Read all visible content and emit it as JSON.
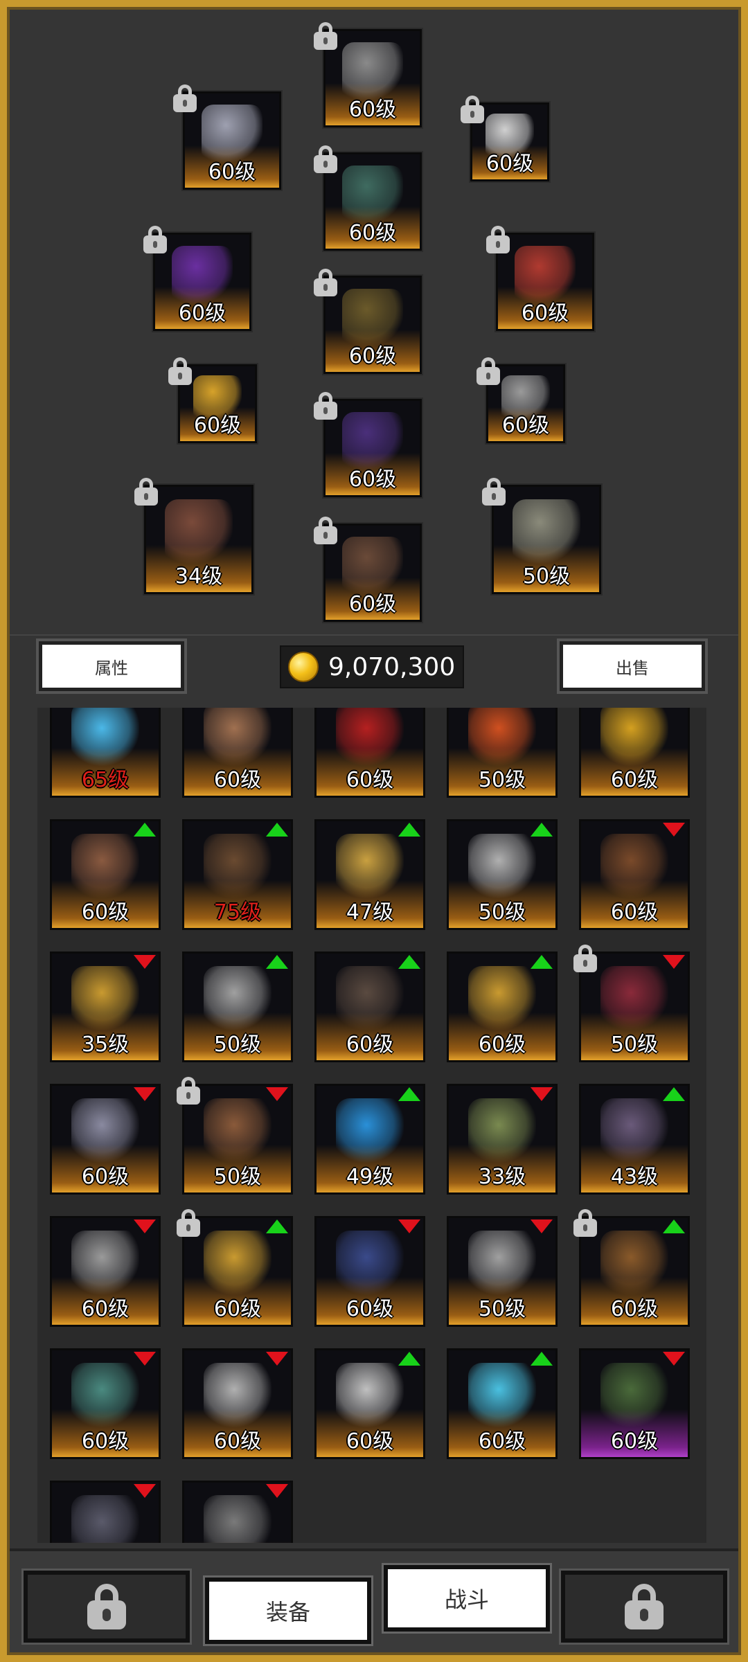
{
  "equipped": [
    {
      "id": "helmet",
      "level": "60级",
      "locked": true,
      "color": "#8a8a8a"
    },
    {
      "id": "mask",
      "level": "60级",
      "locked": true,
      "color": "#9ea0b0"
    },
    {
      "id": "amulet",
      "level": "60级",
      "locked": true,
      "color": "#d0d0d0"
    },
    {
      "id": "armor",
      "level": "60级",
      "locked": true,
      "color": "#3f6b60"
    },
    {
      "id": "gloves",
      "level": "60级",
      "locked": true,
      "color": "#6a2fa0"
    },
    {
      "id": "belt",
      "level": "60级",
      "locked": true,
      "color": "#b03a30"
    },
    {
      "id": "bracer",
      "level": "60级",
      "locked": true,
      "color": "#6b5a2a"
    },
    {
      "id": "ring-left",
      "level": "60级",
      "locked": true,
      "color": "#d6a22a"
    },
    {
      "id": "pants",
      "level": "60级",
      "locked": true,
      "color": "#4a2f7a"
    },
    {
      "id": "ring-right",
      "level": "60级",
      "locked": true,
      "color": "#9a9a9a"
    },
    {
      "id": "crossbow",
      "level": "34级",
      "locked": true,
      "color": "#7a4a3a"
    },
    {
      "id": "boots",
      "level": "60级",
      "locked": true,
      "color": "#6a4a38"
    },
    {
      "id": "shield",
      "level": "50级",
      "locked": true,
      "color": "#8a8a7a"
    }
  ],
  "buttons": {
    "attributes": "属性",
    "sell": "出售"
  },
  "gold": "9,070,300",
  "inventory": [
    {
      "level": "65级",
      "red": true,
      "arrow": null,
      "locked": false,
      "color": "#4bb8e8"
    },
    {
      "level": "60级",
      "red": false,
      "arrow": null,
      "locked": false,
      "color": "#a07050"
    },
    {
      "level": "60级",
      "red": false,
      "arrow": null,
      "locked": false,
      "color": "#b52020"
    },
    {
      "level": "50级",
      "red": false,
      "arrow": null,
      "locked": false,
      "color": "#d05020"
    },
    {
      "level": "60级",
      "red": false,
      "arrow": null,
      "locked": false,
      "color": "#d4a020"
    },
    {
      "level": "60级",
      "red": false,
      "arrow": "up",
      "locked": false,
      "color": "#8a5a40"
    },
    {
      "level": "75级",
      "red": true,
      "arrow": "up",
      "locked": false,
      "color": "#6a4a30"
    },
    {
      "level": "47级",
      "red": false,
      "arrow": "up",
      "locked": false,
      "color": "#c9a040"
    },
    {
      "level": "50级",
      "red": false,
      "arrow": "up",
      "locked": false,
      "color": "#b0b0b0"
    },
    {
      "level": "60级",
      "red": false,
      "arrow": "down",
      "locked": false,
      "color": "#7a4a2a"
    },
    {
      "level": "35级",
      "red": false,
      "arrow": "down",
      "locked": false,
      "color": "#c99a30"
    },
    {
      "level": "50级",
      "red": false,
      "arrow": "up",
      "locked": false,
      "color": "#a0a0a0"
    },
    {
      "level": "60级",
      "red": false,
      "arrow": "up",
      "locked": false,
      "color": "#5a4a40"
    },
    {
      "level": "60级",
      "red": false,
      "arrow": "up",
      "locked": false,
      "color": "#c99a30"
    },
    {
      "level": "50级",
      "red": false,
      "arrow": "down",
      "locked": true,
      "color": "#8a2a3a"
    },
    {
      "level": "60级",
      "red": false,
      "arrow": "down",
      "locked": false,
      "color": "#8a8aa0"
    },
    {
      "level": "50级",
      "red": false,
      "arrow": "down",
      "locked": true,
      "color": "#8a5a3a"
    },
    {
      "level": "49级",
      "red": false,
      "arrow": "up",
      "locked": false,
      "color": "#2a90d8"
    },
    {
      "level": "33级",
      "red": false,
      "arrow": "down",
      "locked": false,
      "color": "#7a8a50"
    },
    {
      "level": "43级",
      "red": false,
      "arrow": "up",
      "locked": false,
      "color": "#6a5a7a"
    },
    {
      "level": "60级",
      "red": false,
      "arrow": "down",
      "locked": false,
      "color": "#9a9a9a"
    },
    {
      "level": "60级",
      "red": false,
      "arrow": "up",
      "locked": true,
      "color": "#c99a30"
    },
    {
      "level": "60级",
      "red": false,
      "arrow": "down",
      "locked": false,
      "color": "#3a4a8a"
    },
    {
      "level": "50级",
      "red": false,
      "arrow": "down",
      "locked": false,
      "color": "#a0a0a0"
    },
    {
      "level": "60级",
      "red": false,
      "arrow": "up",
      "locked": true,
      "color": "#8a5a2a"
    },
    {
      "level": "60级",
      "red": false,
      "arrow": "down",
      "locked": false,
      "color": "#4a8a80"
    },
    {
      "level": "60级",
      "red": false,
      "arrow": "down",
      "locked": false,
      "color": "#b0b0b0"
    },
    {
      "level": "60级",
      "red": false,
      "arrow": "up",
      "locked": false,
      "color": "#c0c0c0"
    },
    {
      "level": "60级",
      "red": false,
      "arrow": "up",
      "locked": false,
      "color": "#4ac0e0"
    },
    {
      "level": "60级",
      "red": false,
      "arrow": "down",
      "locked": false,
      "color": "#4a6a3a",
      "purple": true
    },
    {
      "level": "",
      "red": false,
      "arrow": "down",
      "locked": false,
      "color": "#5a5a6a"
    },
    {
      "level": "",
      "red": false,
      "arrow": "down",
      "locked": false,
      "color": "#7a7a7a"
    }
  ],
  "tabs": {
    "equip": "装备",
    "battle": "战斗"
  }
}
